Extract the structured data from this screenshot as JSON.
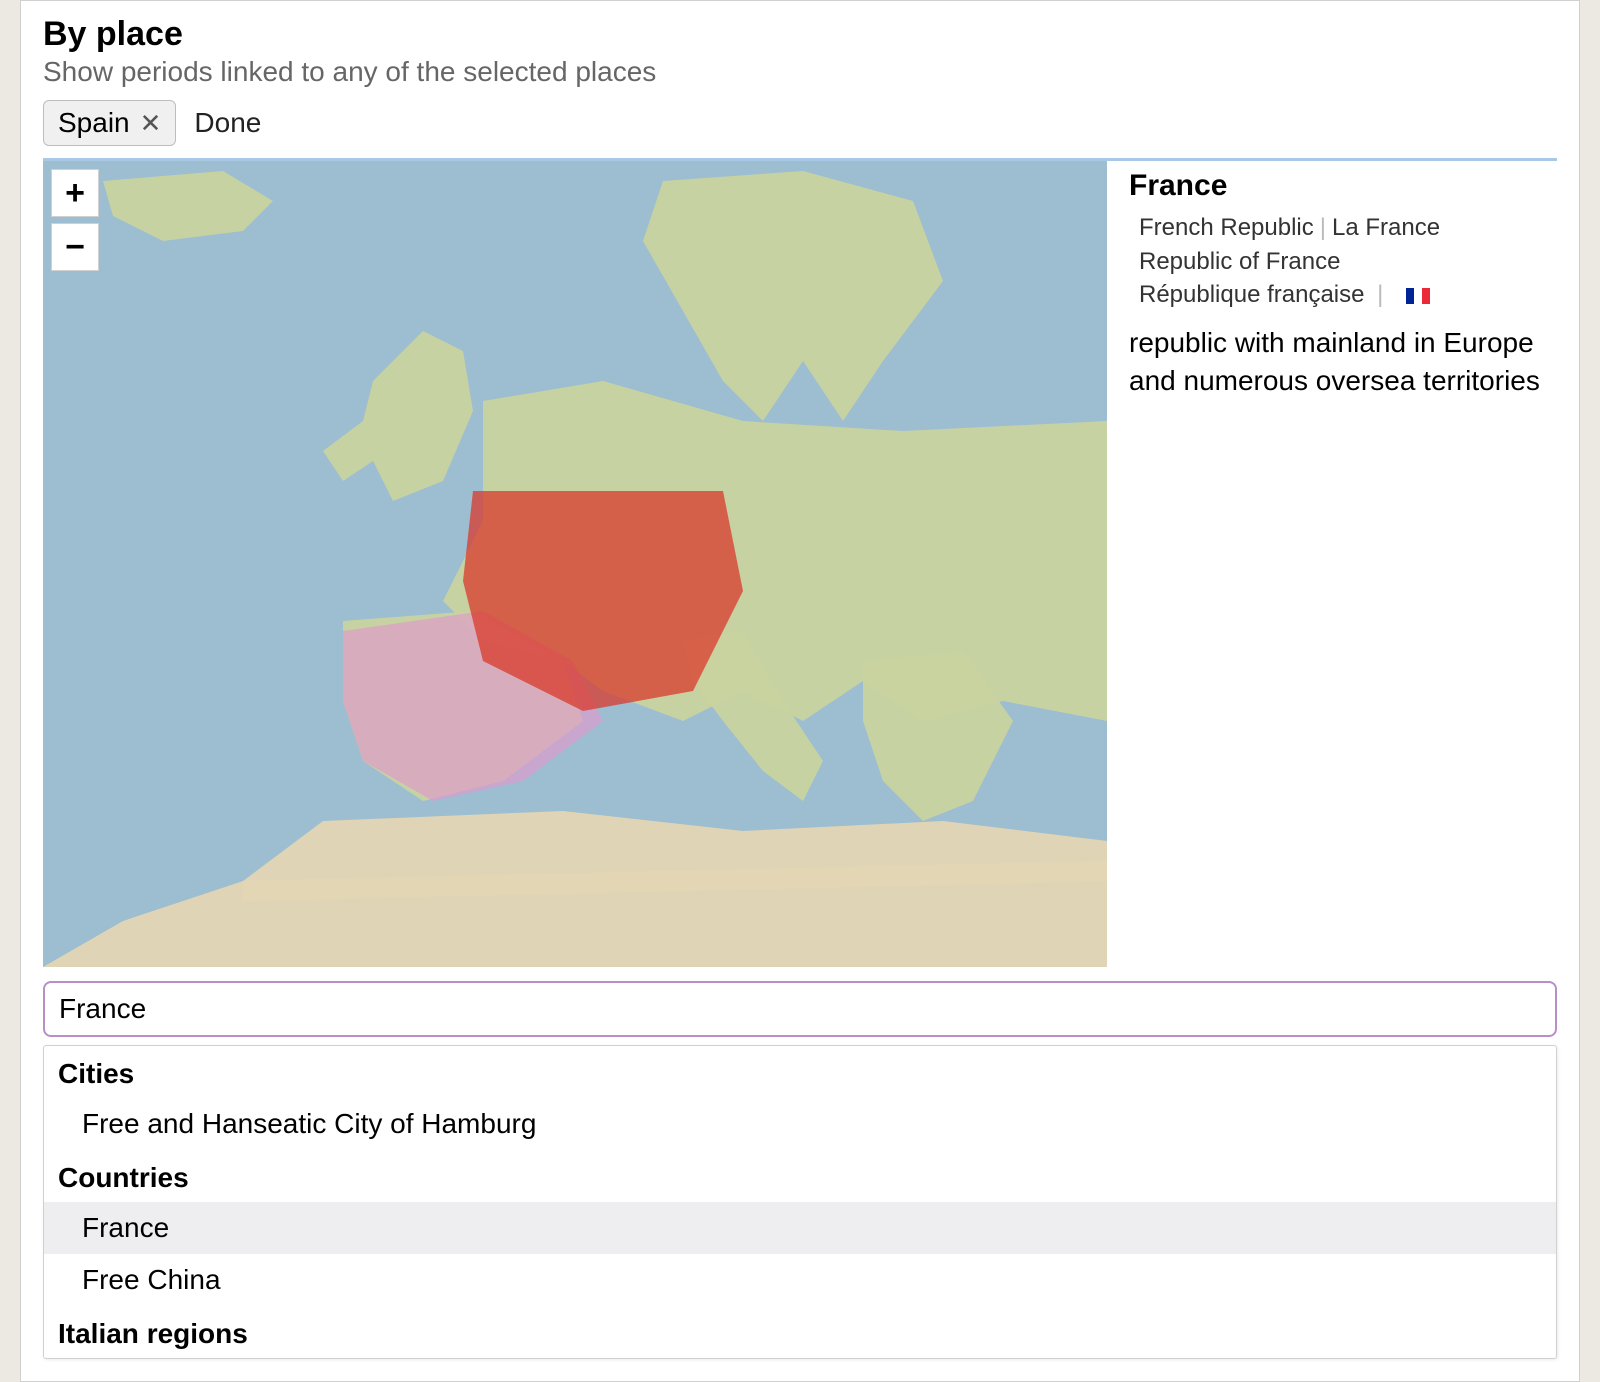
{
  "header": {
    "title": "By place",
    "subtitle": "Show periods linked to any of the selected places"
  },
  "selected_chips": [
    {
      "label": "Spain"
    }
  ],
  "done_label": "Done",
  "zoom": {
    "in": "+",
    "out": "−"
  },
  "detail": {
    "title": "France",
    "aliases": [
      "French Republic",
      "La France",
      "Republic of France",
      "République française"
    ],
    "flag": "france-flag",
    "description": "republic with mainland in Europe and numerous oversea territories"
  },
  "search": {
    "value": "France"
  },
  "suggestions": {
    "groups": [
      {
        "title": "Cities",
        "items": [
          {
            "label": "Free and Hanseatic City of Hamburg",
            "selected": false
          }
        ]
      },
      {
        "title": "Countries",
        "items": [
          {
            "label": "France",
            "selected": true
          },
          {
            "label": "Free China",
            "selected": false
          }
        ]
      },
      {
        "title": "Italian regions",
        "items": []
      }
    ]
  },
  "map": {
    "overlays": [
      {
        "name": "france-overlay",
        "color": "red",
        "approx_bounds": "Metropolitan France"
      },
      {
        "name": "spain-overlay",
        "color": "pink",
        "approx_bounds": "Iberian Peninsula"
      }
    ],
    "view": {
      "center_approx": "Western Europe / Mediterranean",
      "projection": "Web Mercator (visual)"
    }
  }
}
